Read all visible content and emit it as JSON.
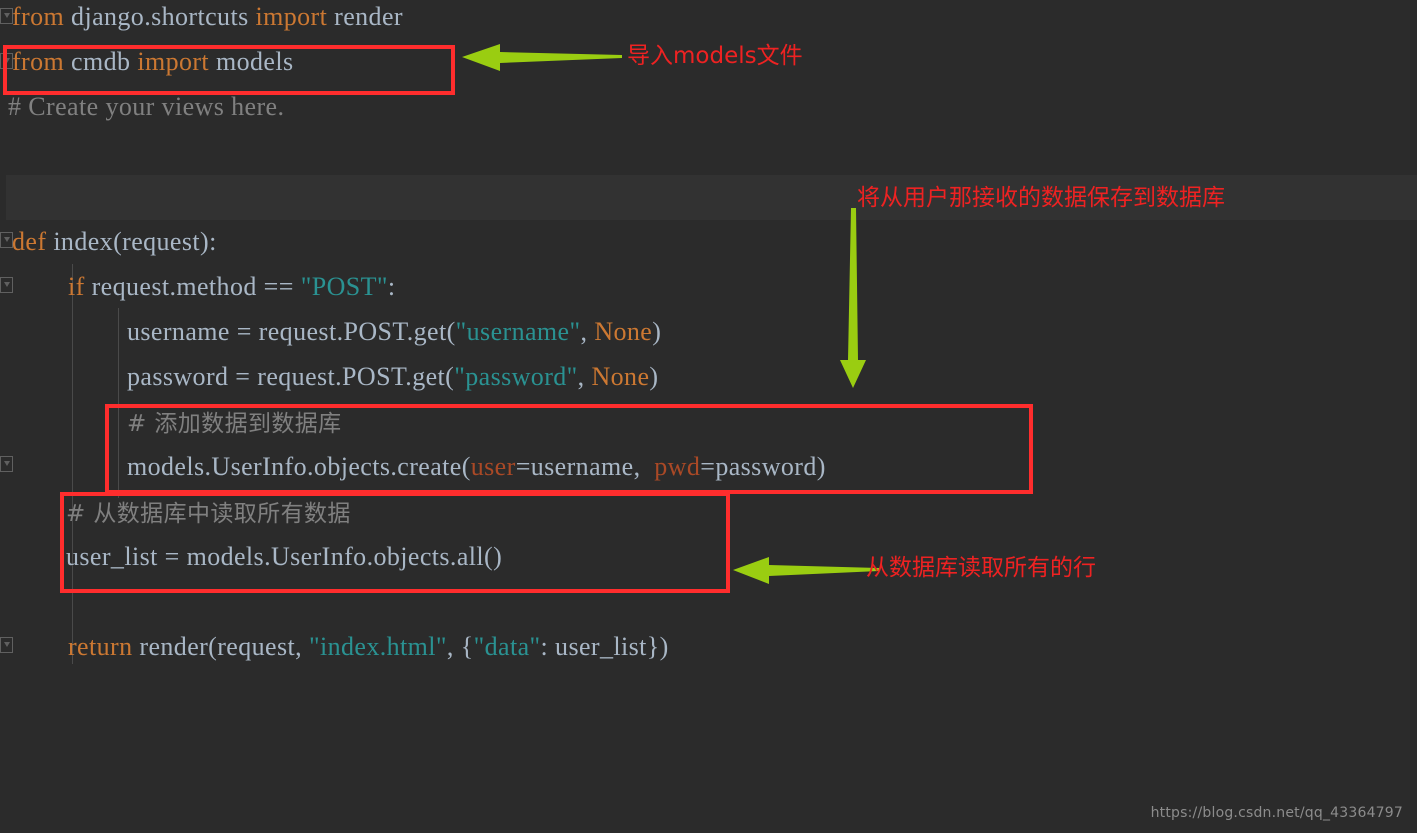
{
  "editor": {
    "background_color": "#2b2b2b",
    "highlight_band_color": "#323232",
    "default_text_color": "#a9b7c6",
    "keyword_color": "#cc7832",
    "string_color": "#2a9292",
    "comment_color": "#808080",
    "kwarg_color": "#aa4926",
    "code_lines": [
      {
        "id": "line-import-django",
        "text": "from django.shortcuts import render"
      },
      {
        "id": "line-import-models",
        "text": "from cmdb import models"
      },
      {
        "id": "line-create-comment",
        "text": "# Create your views here."
      },
      {
        "id": "line-def-index",
        "text": "def index(request):"
      },
      {
        "id": "line-if-post",
        "text": "    if request.method == \"POST\":"
      },
      {
        "id": "line-username",
        "text": "        username = request.POST.get(\"username\", None)"
      },
      {
        "id": "line-password",
        "text": "        password = request.POST.get(\"password\", None)"
      },
      {
        "id": "line-add-comment",
        "text": "        # 添加数据到数据库"
      },
      {
        "id": "line-create-obj",
        "text": "        models.UserInfo.objects.create(user=username, pwd=password)"
      },
      {
        "id": "line-read-comment",
        "text": "    # 从数据库中读取所有数据"
      },
      {
        "id": "line-user-list",
        "text": "    user_list = models.UserInfo.objects.all()"
      },
      {
        "id": "line-return",
        "text": "    return render(request, \"index.html\", {\"data\": user_list})"
      }
    ],
    "tokens": {
      "from": "from",
      "import": "import",
      "def": "def",
      "if": "if",
      "return": "return",
      "none": "None",
      "django_shortcuts": "django.shortcuts",
      "render_name": "render",
      "cmdb": "cmdb",
      "models": "models",
      "create_comment": "# Create your views here.",
      "index_sig": "index(request):",
      "request_method": "request.method ==",
      "post_str": "\"POST\"",
      "colon": ":",
      "username_assign": "username = request.POST.get(",
      "username_str": "\"username\"",
      "password_assign": "password = request.POST.get(",
      "password_str": "\"password\"",
      "comma_space": ", ",
      "close_paren": ")",
      "add_comment_cjk": "# 添加数据到数据库",
      "create_call": "models.UserInfo.objects.create(",
      "user_kwarg": "user",
      "eq_username": "=username,  ",
      "pwd_kwarg": "pwd",
      "eq_password": "=password)",
      "read_comment_cjk": "# 从数据库中读取所有数据",
      "user_list_line": "user_list = models.UserInfo.objects.all()",
      "render_call": "render(request, ",
      "index_html_str": "\"index.html\"",
      "brace_open": ", {",
      "data_str": "\"data\"",
      "data_tail": ": user_list})"
    }
  },
  "annotations": {
    "arrow_color": "#9acd11",
    "box_color": "#ff2d2d",
    "text_color": "#ee2222",
    "notes": [
      {
        "id": "note-import-models",
        "text": "导入models文件"
      },
      {
        "id": "note-save-to-db",
        "text": "将从用户那接收的数据保存到数据库"
      },
      {
        "id": "note-read-all-rows",
        "text": "从数据库读取所有的行"
      }
    ],
    "boxes": [
      {
        "id": "box-import-models",
        "target": "from cmdb import models"
      },
      {
        "id": "box-create-record",
        "target": "# 添加数据到数据库 / models.UserInfo.objects.create(...)"
      },
      {
        "id": "box-read-all",
        "target": "# 从数据库中读取所有数据 / user_list = models.UserInfo.objects.all()"
      }
    ],
    "arrows": [
      {
        "id": "arrow-to-import-box",
        "direction": "left"
      },
      {
        "id": "arrow-to-create-box",
        "direction": "down"
      },
      {
        "id": "arrow-to-read-box",
        "direction": "left"
      }
    ]
  },
  "watermark": {
    "text": "https://blog.csdn.net/qq_43364797"
  }
}
